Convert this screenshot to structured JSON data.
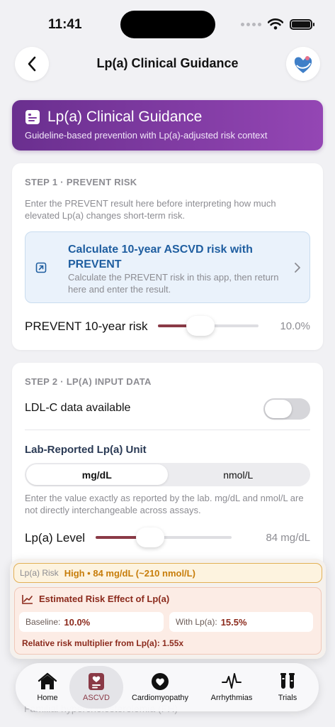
{
  "status": {
    "time": "11:41"
  },
  "nav": {
    "title": "Lp(a) Clinical Guidance"
  },
  "hero": {
    "title": "Lp(a) Clinical Guidance",
    "subtitle": "Guideline-based prevention with Lp(a)-adjusted risk context"
  },
  "step1": {
    "label": "STEP 1 · PREVENT RISK",
    "description": "Enter the PREVENT result here before interpreting how much elevated Lp(a) changes short-term risk.",
    "link_title": "Calculate 10-year ASCVD risk with PREVENT",
    "link_subtitle": "Calculate the PREVENT risk in this app, then return here and enter the result.",
    "slider_label": "PREVENT 10-year risk",
    "slider_value": "10.0%",
    "slider_fraction": 0.42
  },
  "step2": {
    "label": "STEP 2 · LP(A) INPUT DATA",
    "ldl_label": "LDL-C data available",
    "ldl_enabled": false,
    "unit_title": "Lab-Reported Lp(a) Unit",
    "unit_options": [
      "mg/dL",
      "nmol/L"
    ],
    "unit_selected": "mg/dL",
    "unit_note": "Enter the value exactly as reported by the lab. mg/dL and nmol/L are not directly interchangeable across assays.",
    "level_label": "Lp(a) Level",
    "level_value": "84 mg/dL",
    "level_fraction": 0.4
  },
  "risk": {
    "label": "Lp(a) Risk",
    "value": "High • 84 mg/dL (~210 nmol/L)",
    "effect_title": "Estimated Risk Effect of Lp(a)",
    "baseline_label": "Baseline:",
    "baseline_value": "10.0%",
    "with_label": "With Lp(a):",
    "with_value": "15.5%",
    "multiplier": "Relative risk multiplier from Lp(a): 1.55x"
  },
  "ghost_text": "Familial hypercholesterolemia (FH)",
  "tabs": [
    {
      "label": "Home",
      "icon": "home-icon"
    },
    {
      "label": "ASCVD",
      "icon": "heart-doc-icon",
      "active": true
    },
    {
      "label": "Cardiomyopathy",
      "icon": "heart-icon"
    },
    {
      "label": "Arrhythmias",
      "icon": "pulse-icon"
    },
    {
      "label": "Trials",
      "icon": "test-tubes-icon"
    }
  ],
  "colors": {
    "accent": "#8a3a46",
    "hero_start": "#6a2f8f",
    "hero_end": "#9446b4",
    "link_text": "#1f5ea0",
    "risk_high": "#c77d0a"
  }
}
